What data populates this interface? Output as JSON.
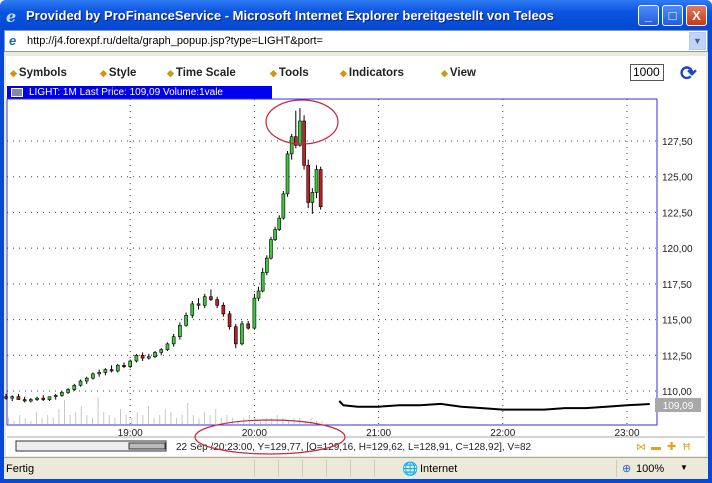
{
  "window": {
    "title": "Provided by ProFinanceService - Microsoft Internet Explorer bereitgestellt von Teleos",
    "minimize": "_",
    "maximize": "□",
    "close": "X"
  },
  "address": {
    "url": "http://j4.forexpf.ru/delta/graph_popup.jsp?type=LIGHT&port="
  },
  "toolbar": {
    "menus": [
      "Symbols",
      "Style",
      "Time Scale",
      "Tools",
      "Indicators",
      "View"
    ],
    "bars_value": "1000",
    "refresh_icon": "refresh-icon"
  },
  "chart_header": "LIGHT: 1M Last Price: 109,09 Volume:1vale",
  "chart_data": {
    "type": "candlestick",
    "symbol": "LIGHT",
    "interval": "1M",
    "ylim": [
      108.5,
      130.5
    ],
    "y_ticks": [
      110,
      112.5,
      115,
      117.5,
      120,
      122.5,
      125,
      127.5
    ],
    "y_tick_labels": [
      "110,00",
      "112,50",
      "115,00",
      "117,50",
      "120,00",
      "122,50",
      "125,00",
      "127,50"
    ],
    "x_ticks": [
      60,
      120,
      180,
      240,
      300
    ],
    "x_tick_labels": [
      "19:00",
      "20:00",
      "21:00",
      "22:00",
      "23:00"
    ],
    "x_unit": "minutes since 18:00",
    "last_price": "109,09",
    "candles": [
      [
        0,
        109.6,
        109.8,
        109.4,
        109.5
      ],
      [
        3,
        109.5,
        109.7,
        109.3,
        109.6
      ],
      [
        6,
        109.6,
        109.8,
        109.4,
        109.4
      ],
      [
        9,
        109.4,
        109.6,
        109.2,
        109.3
      ],
      [
        12,
        109.3,
        109.5,
        109.2,
        109.4
      ],
      [
        15,
        109.4,
        109.6,
        109.3,
        109.5
      ],
      [
        18,
        109.5,
        109.7,
        109.3,
        109.4
      ],
      [
        21,
        109.4,
        109.6,
        109.3,
        109.6
      ],
      [
        24,
        109.6,
        109.8,
        109.4,
        109.7
      ],
      [
        27,
        109.7,
        110.0,
        109.6,
        109.9
      ],
      [
        30,
        109.9,
        110.2,
        109.8,
        110.1
      ],
      [
        33,
        110.1,
        110.5,
        110.0,
        110.4
      ],
      [
        36,
        110.4,
        110.8,
        110.3,
        110.7
      ],
      [
        39,
        110.7,
        111.0,
        110.5,
        110.9
      ],
      [
        42,
        110.9,
        111.3,
        110.8,
        111.2
      ],
      [
        45,
        111.2,
        111.5,
        111.0,
        111.3
      ],
      [
        48,
        111.3,
        111.6,
        111.1,
        111.5
      ],
      [
        51,
        111.5,
        111.8,
        111.3,
        111.4
      ],
      [
        54,
        111.4,
        111.9,
        111.3,
        111.8
      ],
      [
        57,
        111.8,
        112.0,
        111.6,
        111.7
      ],
      [
        60,
        111.7,
        112.2,
        111.6,
        112.1
      ],
      [
        63,
        112.1,
        112.6,
        112.0,
        112.5
      ],
      [
        66,
        112.5,
        112.7,
        112.1,
        112.3
      ],
      [
        69,
        112.3,
        112.6,
        112.2,
        112.4
      ],
      [
        72,
        112.4,
        112.8,
        112.3,
        112.7
      ],
      [
        75,
        112.7,
        113.0,
        112.5,
        112.9
      ],
      [
        78,
        112.9,
        113.4,
        112.8,
        113.3
      ],
      [
        81,
        113.3,
        114.0,
        113.1,
        113.8
      ],
      [
        84,
        113.8,
        114.8,
        113.6,
        114.6
      ],
      [
        87,
        114.6,
        115.5,
        114.5,
        115.3
      ],
      [
        90,
        115.3,
        116.3,
        115.1,
        116.1
      ],
      [
        93,
        116.1,
        116.5,
        115.7,
        116.0
      ],
      [
        96,
        116.0,
        116.8,
        115.8,
        116.6
      ],
      [
        99,
        116.6,
        117.1,
        116.3,
        116.4
      ],
      [
        102,
        116.4,
        116.6,
        115.8,
        116.0
      ],
      [
        105,
        116.0,
        116.2,
        115.2,
        115.4
      ],
      [
        108,
        115.4,
        115.6,
        114.3,
        114.5
      ],
      [
        111,
        114.5,
        114.7,
        113.0,
        113.3
      ],
      [
        114,
        113.3,
        114.9,
        113.2,
        114.7
      ],
      [
        117,
        114.7,
        114.9,
        114.3,
        114.4
      ],
      [
        120,
        114.4,
        116.8,
        114.3,
        116.5
      ],
      [
        122,
        116.5,
        117.3,
        116.3,
        117.0
      ],
      [
        124,
        117.0,
        118.6,
        116.9,
        118.3
      ],
      [
        126,
        118.3,
        119.5,
        118.1,
        119.3
      ],
      [
        128,
        119.3,
        120.8,
        119.2,
        120.6
      ],
      [
        130,
        120.6,
        121.5,
        120.5,
        121.3
      ],
      [
        132,
        121.3,
        122.3,
        121.2,
        122.1
      ],
      [
        134,
        122.1,
        124.0,
        122.0,
        123.8
      ],
      [
        136,
        123.8,
        126.8,
        123.6,
        126.6
      ],
      [
        138,
        126.6,
        128.0,
        126.2,
        127.8
      ],
      [
        140,
        127.8,
        129.62,
        127.0,
        127.2
      ],
      [
        142,
        127.2,
        129.8,
        127.1,
        128.9
      ],
      [
        144,
        128.9,
        129.3,
        125.5,
        125.8
      ],
      [
        146,
        125.8,
        126.2,
        122.8,
        123.2
      ],
      [
        148,
        123.2,
        124.2,
        122.4,
        123.9
      ],
      [
        150,
        123.9,
        125.8,
        123.5,
        125.5
      ],
      [
        152,
        125.5,
        125.7,
        122.7,
        122.9
      ]
    ],
    "line": [
      [
        161,
        109.3
      ],
      [
        163,
        109.0
      ],
      [
        170,
        108.9
      ],
      [
        180,
        108.9
      ],
      [
        190,
        109.0
      ],
      [
        200,
        109.0
      ],
      [
        210,
        109.1
      ],
      [
        220,
        108.9
      ],
      [
        230,
        108.8
      ],
      [
        240,
        108.7
      ],
      [
        250,
        108.7
      ],
      [
        260,
        108.7
      ],
      [
        270,
        108.8
      ],
      [
        280,
        108.8
      ],
      [
        290,
        108.9
      ],
      [
        300,
        109.0
      ],
      [
        311,
        109.09
      ]
    ],
    "volume": [
      2,
      1,
      3,
      2,
      1,
      4,
      2,
      3,
      2,
      5,
      8,
      3,
      4,
      6,
      3,
      2,
      9,
      4,
      3,
      2,
      5,
      3,
      2,
      4,
      3,
      6,
      2,
      3,
      5,
      4,
      2,
      3,
      7,
      3,
      2,
      4,
      3,
      5,
      2,
      3,
      2,
      1,
      2,
      3,
      2,
      1,
      2,
      2,
      3,
      2,
      1,
      2,
      2,
      1,
      2,
      1,
      1
    ]
  },
  "status_line": "22 Sep /20:23:00, Y=129,77, [O=129,16, H=129,62, L=128,91, C=128,92], V=82",
  "statusbar": {
    "text": "Fertig",
    "zone": "Internet",
    "zoom": "100%"
  }
}
